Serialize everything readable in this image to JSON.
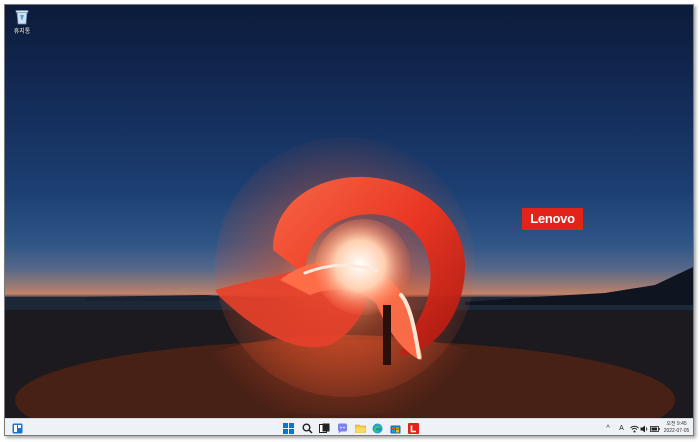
{
  "desktop": {
    "recycle_bin_label": "휴지통",
    "lenovo_logo_text": "Lenovo",
    "colors": {
      "lenovo_red": "#e2231a",
      "swirl_red": "#ff3d23"
    }
  },
  "taskbar": {
    "left_widget_icon": "widgets-icon",
    "pinned": [
      {
        "name": "start-button",
        "icon": "windows-start-icon"
      },
      {
        "name": "search-button",
        "icon": "search-icon"
      },
      {
        "name": "task-view-button",
        "icon": "task-view-icon"
      },
      {
        "name": "chat-button",
        "icon": "chat-icon"
      },
      {
        "name": "file-explorer-button",
        "icon": "folder-icon"
      },
      {
        "name": "edge-button",
        "icon": "edge-icon"
      },
      {
        "name": "store-button",
        "icon": "store-icon"
      },
      {
        "name": "lenovo-app-button",
        "icon": "lenovo-l-icon"
      }
    ],
    "tray": {
      "chevron": "^",
      "ime": "A",
      "clock_period": "오전 9:45",
      "clock_date": "2022-07-05"
    }
  }
}
